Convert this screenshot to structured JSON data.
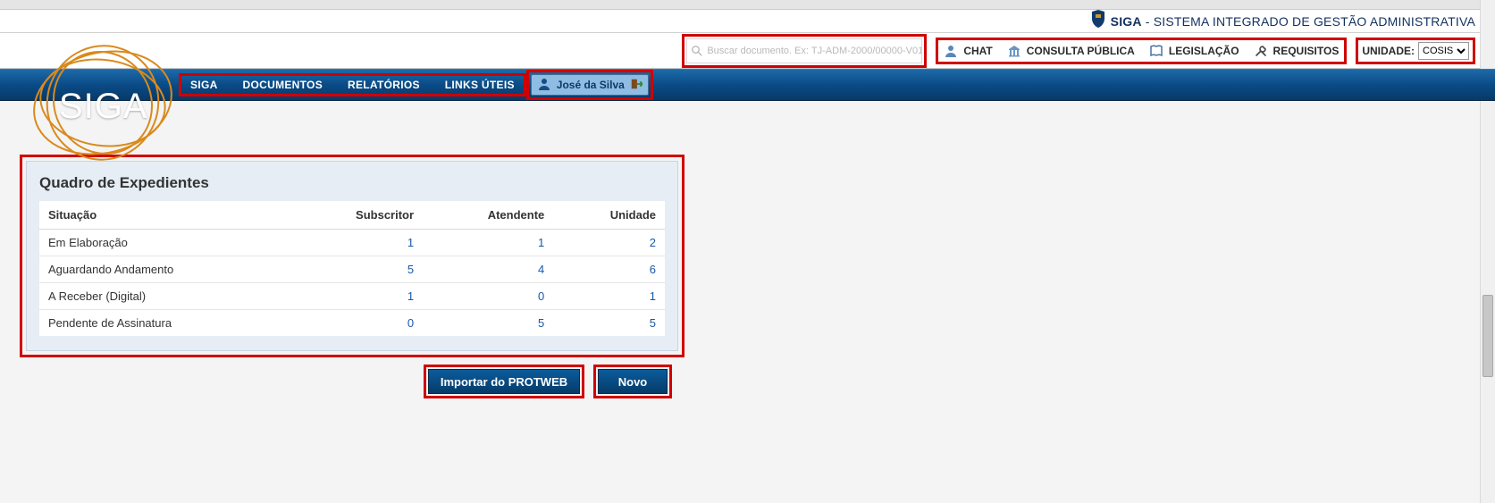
{
  "header": {
    "siga_bold": "SIGA",
    "siga_rest": " - SISTEMA INTEGRADO DE GESTÃO ADMINISTRATIVA"
  },
  "search": {
    "placeholder": "Buscar documento. Ex: TJ-ADM-2000/00000-V01"
  },
  "util": {
    "chat": "CHAT",
    "consulta": "CONSULTA PÚBLICA",
    "legislacao": "LEGISLAÇÃO",
    "requisitos": "REQUISITOS"
  },
  "unidade": {
    "label": "UNIDADE:",
    "value": "COSIS"
  },
  "nav": {
    "siga": "SIGA",
    "documentos": "DOCUMENTOS",
    "relatorios": "RELATÓRIOS",
    "links": "LINKS ÚTEIS"
  },
  "user": {
    "name": "José da Silva"
  },
  "panel": {
    "title": "Quadro de Expedientes",
    "cols": {
      "situacao": "Situação",
      "subscritor": "Subscritor",
      "atendente": "Atendente",
      "unidade": "Unidade"
    },
    "rows": [
      {
        "situacao": "Em Elaboração",
        "subscritor": "1",
        "atendente": "1",
        "unidade": "2"
      },
      {
        "situacao": "Aguardando Andamento",
        "subscritor": "5",
        "atendente": "4",
        "unidade": "6"
      },
      {
        "situacao": "A Receber (Digital)",
        "subscritor": "1",
        "atendente": "0",
        "unidade": "1"
      },
      {
        "situacao": "Pendente de Assinatura",
        "subscritor": "0",
        "atendente": "5",
        "unidade": "5"
      }
    ]
  },
  "buttons": {
    "importar": "Importar do PROTWEB",
    "novo": "Novo"
  },
  "logo_text": "SIGA"
}
